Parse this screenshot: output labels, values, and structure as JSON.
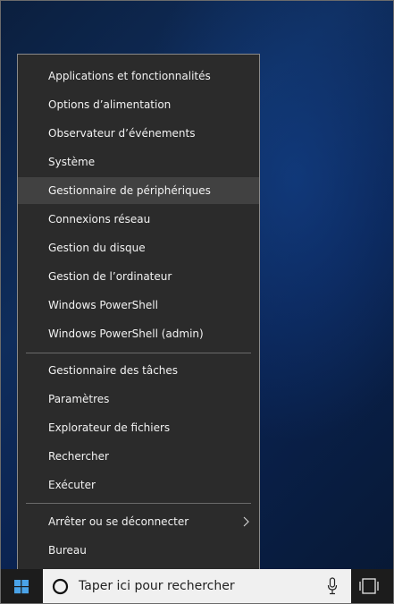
{
  "menu": {
    "groups": [
      {
        "items": [
          {
            "label": "Applications et fonctionnalités"
          },
          {
            "label": "Options d’alimentation"
          },
          {
            "label": "Observateur d’événements"
          },
          {
            "label": "Système"
          },
          {
            "label": "Gestionnaire de périphériques",
            "state": "hovered"
          },
          {
            "label": "Connexions réseau"
          },
          {
            "label": "Gestion du disque"
          },
          {
            "label": "Gestion de l’ordinateur"
          },
          {
            "label": "Windows PowerShell"
          },
          {
            "label": "Windows PowerShell (admin)"
          }
        ]
      },
      {
        "items": [
          {
            "label": "Gestionnaire des tâches"
          },
          {
            "label": "Paramètres"
          },
          {
            "label": "Explorateur de fichiers"
          },
          {
            "label": "Rechercher"
          },
          {
            "label": "Exécuter"
          }
        ]
      },
      {
        "items": [
          {
            "label": "Arrêter ou se déconnecter",
            "submenu": true
          },
          {
            "label": "Bureau"
          }
        ]
      }
    ]
  },
  "taskbar": {
    "start_icon": "windows-logo-icon",
    "search": {
      "placeholder": "Taper ici pour rechercher",
      "icon": "cortana-ring-icon",
      "mic_icon": "microphone-icon"
    },
    "task_view_icon": "task-view-icon"
  },
  "colors": {
    "menu_bg": "#2b2b2b",
    "menu_hover": "#414141",
    "menu_text": "#f2f2f2",
    "taskbar_bg": "#1c1c1c",
    "search_bg": "#f0f0f0"
  }
}
